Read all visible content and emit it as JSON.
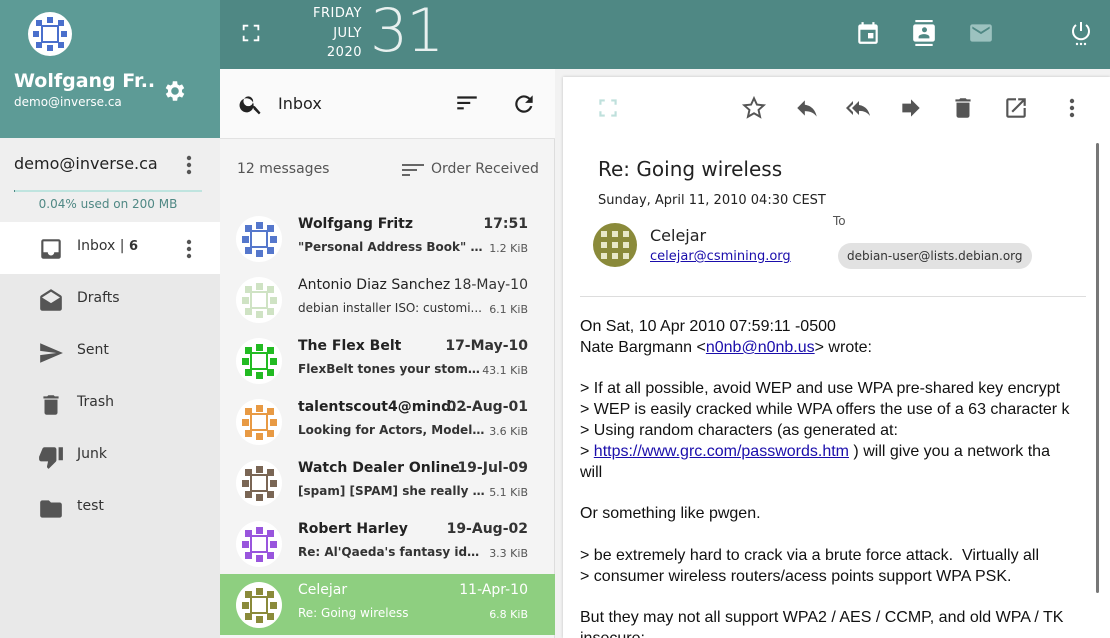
{
  "topbar": {
    "weekday": "FRIDAY",
    "month": "JULY",
    "year": "2020",
    "day": "31",
    "icons": [
      "fullscreen-icon",
      "calendar-icon",
      "contacts-icon",
      "mail-icon",
      "power-icon"
    ]
  },
  "user": {
    "name": "Wolfgang Fr...",
    "email": "demo@inverse.ca"
  },
  "account": {
    "name": "demo@inverse.ca",
    "quota_text": "0.04% used on 200 MB",
    "quota_fraction": 0.0004
  },
  "folders": [
    {
      "label": "Inbox",
      "count": "6",
      "icon": "inbox-icon",
      "active": true
    },
    {
      "label": "Drafts",
      "icon": "drafts-icon"
    },
    {
      "label": "Sent",
      "icon": "send-icon"
    },
    {
      "label": "Trash",
      "icon": "trash-icon"
    },
    {
      "label": "Junk",
      "icon": "thumb-down-icon"
    },
    {
      "label": "test",
      "icon": "folder-icon"
    }
  ],
  "list": {
    "search_label": "Inbox",
    "count_text": "12 messages",
    "order_label": "Order Received",
    "messages": [
      {
        "sender": "Wolfgang Fritz",
        "date": "17:51",
        "subject": "\"Personal Address Book\" has...",
        "size": "1.2 KiB",
        "unread": true,
        "color": "#5577cc"
      },
      {
        "sender": "Antonio Diaz Sanchez",
        "date": "18-May-10",
        "subject": "debian installer ISO: customi...",
        "size": "6.1 KiB",
        "unread": false,
        "color": "#cfe3c4"
      },
      {
        "sender": "The Flex Belt",
        "date": "17-May-10",
        "subject": "FlexBelt tones your stomach...",
        "size": "43.1 KiB",
        "unread": true,
        "color": "#22bb22"
      },
      {
        "sender": "talentscout4@mind...",
        "date": "02-Aug-01",
        "subject": "Looking for Actors, Models, S...",
        "size": "3.6 KiB",
        "unread": true,
        "color": "#e89a44"
      },
      {
        "sender": "Watch Dealer Online",
        "date": "19-Jul-09",
        "subject": "[spam] [SPAM] she really wan...",
        "size": "5.1 KiB",
        "unread": true,
        "color": "#7a6655"
      },
      {
        "sender": "Robert Harley",
        "date": "19-Aug-02",
        "subject": "Re: Al'Qaeda's fantasy ideolo...",
        "size": "3.3 KiB",
        "unread": true,
        "color": "#9955dd"
      },
      {
        "sender": "Celejar",
        "date": "11-Apr-10",
        "subject": "Re: Going wireless",
        "size": "6.8 KiB",
        "unread": false,
        "selected": true,
        "color": "#8a8a3a"
      }
    ]
  },
  "viewer": {
    "subject": "Re: Going wireless",
    "date": "Sunday, April 11, 2010 04:30 CEST",
    "from_name": "Celejar",
    "from_email": "celejar@csmining.org",
    "to_label": "To",
    "to_address": "debian-user@lists.debian.org",
    "body": {
      "line1": "On Sat, 10 Apr 2010 07:59:11 -0500",
      "line2_prefix": "Nate Bargmann <",
      "line2_link": "n0nb@n0nb.us",
      "line2_suffix": "> wrote:",
      "line3": "> If at all possible, avoid WEP and use WPA pre-shared key encrypt",
      "line4": "> WEP is easily cracked while WPA offers the use of a 63 character k",
      "line5": "> Using random characters (as generated at:",
      "line6_prefix": "> ",
      "line6_link": "https://www.grc.com/passwords.htm",
      "line6_suffix": " ) will give you a network tha",
      "line7": "will",
      "line8": "Or something like pwgen.",
      "line9": "> be extremely hard to crack via a brute force attack.  Virtually all",
      "line10": "> consumer wireless routers/acess points support WPA PSK.",
      "line11": "But they may not all support WPA2 / AES / CCMP, and old WPA / TK",
      "line12": "insecure:"
    },
    "toolbar_icons": [
      "expand-icon",
      "star-icon",
      "reply-icon",
      "reply-all-icon",
      "forward-icon",
      "delete-icon",
      "open-in-new-icon",
      "more-vert-icon"
    ]
  }
}
